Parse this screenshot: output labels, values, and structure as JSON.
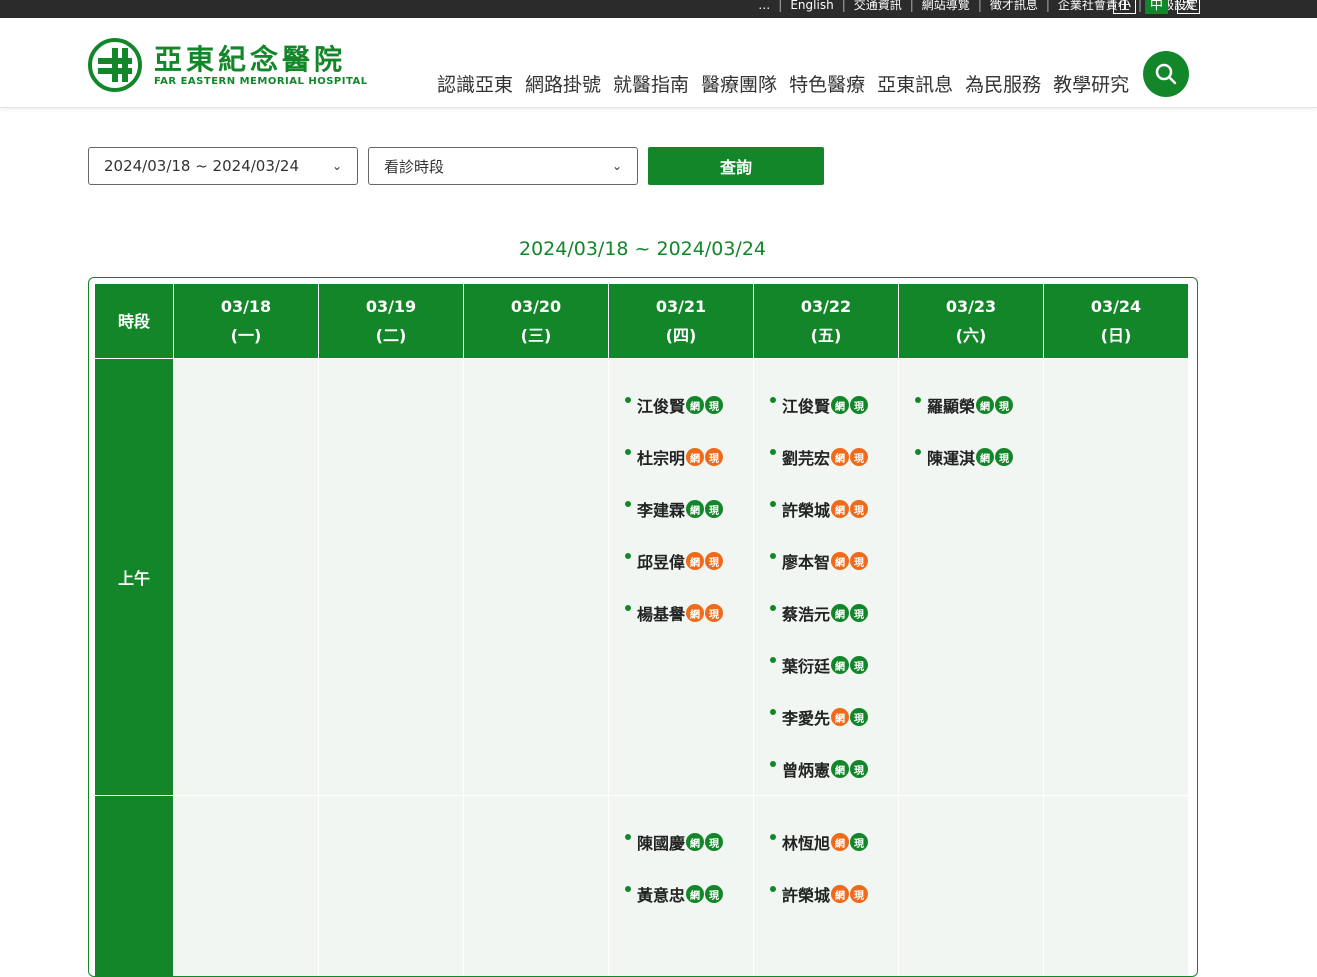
{
  "topbar": {
    "links": [
      "…",
      "English",
      "交通資訊",
      "網站導覽",
      "徵才訊息",
      "企業社會責任",
      "字級設定"
    ],
    "font_sizes": [
      "小",
      "中",
      "大"
    ],
    "active_size": "中"
  },
  "header": {
    "logo_zh": "亞東紀念醫院",
    "logo_en": "FAR EASTERN MEMORIAL HOSPITAL",
    "nav": [
      "認識亞東",
      "網路掛號",
      "就醫指南",
      "醫療團隊",
      "特色醫療",
      "亞東訊息",
      "為民服務",
      "教學研究"
    ]
  },
  "filters": {
    "week_select": "2024/03/18 ~ 2024/03/24",
    "period_select": "看診時段",
    "query_label": "查詢"
  },
  "range_title": "2024/03/18 ~ 2024/03/24",
  "colors": {
    "primary": "#14862a",
    "orange": "#ef6a1a",
    "cell_bg": "#f1f6f3"
  },
  "table": {
    "period_header": "時段",
    "days": [
      {
        "date": "03/18",
        "weekday": "(一)"
      },
      {
        "date": "03/19",
        "weekday": "(二)"
      },
      {
        "date": "03/20",
        "weekday": "(三)"
      },
      {
        "date": "03/21",
        "weekday": "(四)"
      },
      {
        "date": "03/22",
        "weekday": "(五)"
      },
      {
        "date": "03/23",
        "weekday": "(六)"
      },
      {
        "date": "03/24",
        "weekday": "(日)"
      }
    ],
    "badge_web": "網",
    "badge_onsite": "現",
    "rows": [
      {
        "period": "上午",
        "height": 432,
        "cells": [
          [],
          [],
          [],
          [
            {
              "name": "江俊賢",
              "web": "green",
              "onsite": "green"
            },
            {
              "name": "杜宗明",
              "web": "orange",
              "onsite": "orange"
            },
            {
              "name": "李建霖",
              "web": "green",
              "onsite": "green"
            },
            {
              "name": "邱昱偉",
              "web": "orange",
              "onsite": "orange"
            },
            {
              "name": "楊基譽",
              "web": "orange",
              "onsite": "orange"
            }
          ],
          [
            {
              "name": "江俊賢",
              "web": "green",
              "onsite": "green"
            },
            {
              "name": "劉芫宏",
              "web": "orange",
              "onsite": "orange"
            },
            {
              "name": "許榮城",
              "web": "orange",
              "onsite": "orange"
            },
            {
              "name": "廖本智",
              "web": "orange",
              "onsite": "orange"
            },
            {
              "name": "蔡浩元",
              "web": "green",
              "onsite": "green"
            },
            {
              "name": "葉衍廷",
              "web": "green",
              "onsite": "green"
            },
            {
              "name": "李愛先",
              "web": "orange",
              "onsite": "green"
            },
            {
              "name": "曾炳憲",
              "web": "green",
              "onsite": "green"
            }
          ],
          [
            {
              "name": "羅顯榮",
              "web": "green",
              "onsite": "green"
            },
            {
              "name": "陳運淇",
              "web": "green",
              "onsite": "green"
            }
          ],
          []
        ]
      },
      {
        "period": "",
        "height": 200,
        "cells": [
          [],
          [],
          [],
          [
            {
              "name": "陳國慶",
              "web": "green",
              "onsite": "green"
            },
            {
              "name": "黃意忠",
              "web": "green",
              "onsite": "green"
            }
          ],
          [
            {
              "name": "林恆旭",
              "web": "orange",
              "onsite": "green"
            },
            {
              "name": "許榮城",
              "web": "orange",
              "onsite": "orange"
            }
          ],
          [],
          []
        ]
      }
    ]
  }
}
